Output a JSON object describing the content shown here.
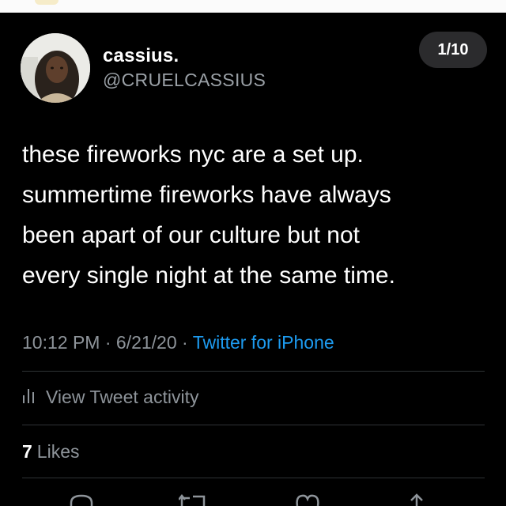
{
  "tweet": {
    "display_name": "cassius.",
    "handle": "@CRUELCASSIUS",
    "counter": "1/10",
    "lines": [
      "these fireworks nyc are a set up.",
      "summertime fireworks have always",
      "been apart of our culture but not",
      "every single night at the same time."
    ],
    "time": "10:12 PM",
    "date": "6/21/20",
    "separator": "·",
    "source": "Twitter for iPhone"
  },
  "activity": {
    "label": "View Tweet activity",
    "icon": "bar-chart-icon"
  },
  "likes": {
    "count": "7",
    "label": "Likes"
  },
  "actions": {
    "icons": [
      "reply-icon",
      "retweet-icon",
      "like-icon",
      "share-icon"
    ]
  },
  "colors": {
    "background": "#000000",
    "text": "#ffffff",
    "muted": "#8e949a",
    "link": "#1d9bf0",
    "pill": "#2b2b2d",
    "divider": "#2f3336"
  }
}
